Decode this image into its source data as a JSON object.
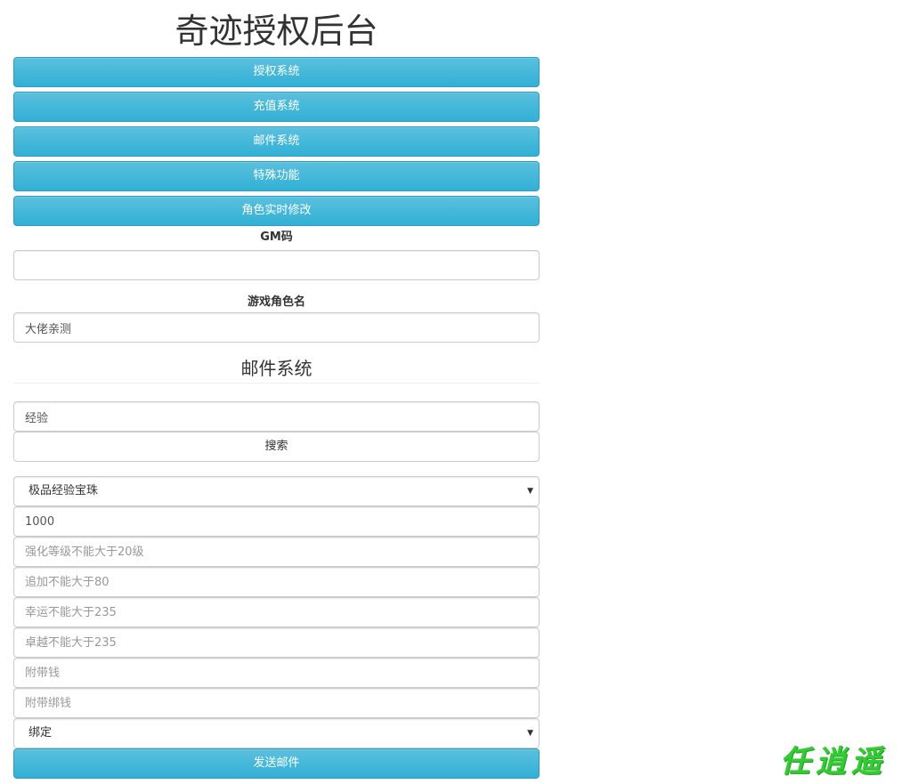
{
  "header": {
    "title": "奇迹授权后台"
  },
  "nav": {
    "items": [
      {
        "label": "授权系统"
      },
      {
        "label": "充值系统"
      },
      {
        "label": "邮件系统"
      },
      {
        "label": "特殊功能"
      },
      {
        "label": "角色实时修改"
      }
    ]
  },
  "gm": {
    "label": "GM码",
    "value": ""
  },
  "role": {
    "label": "游戏角色名",
    "value": "大佬亲测"
  },
  "mail": {
    "heading": "邮件系统",
    "search_value": "经验",
    "search_button": "搜索",
    "item_select": "极品经验宝珠",
    "quantity_value": "1000",
    "fields": {
      "enhance_placeholder": "强化等级不能大于20级",
      "append_placeholder": "追加不能大于80",
      "luck_placeholder": "幸运不能大于235",
      "excellent_placeholder": "卓越不能大于235",
      "money_placeholder": "附带钱",
      "bound_money_placeholder": "附带绑钱"
    },
    "bind_select": "绑定",
    "send_button": "发送邮件"
  },
  "brand": {
    "text": "任逍遥",
    "color": "#33cc33"
  },
  "colors": {
    "accent": "#5bc0de",
    "accent_border": "#2a9fc0"
  }
}
